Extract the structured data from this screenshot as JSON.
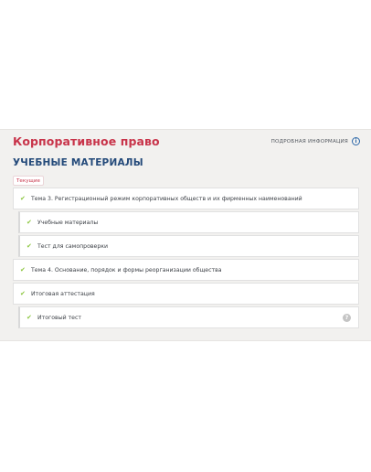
{
  "course": {
    "title": "Корпоративное право",
    "info_link": "ПОДРОБНАЯ ИНФОРМАЦИЯ",
    "info_icon": "info-icon"
  },
  "section": {
    "title": "УЧЕБНЫЕ МАТЕРИАЛЫ",
    "badge": "Текущие"
  },
  "items": [
    {
      "label": "Тема 3. Регистрационный режим корпоративных обществ и их фирменных наименований",
      "completed": true
    },
    {
      "label": "Учебные материалы",
      "completed": true
    },
    {
      "label": "Тест для самопроверки",
      "completed": true
    },
    {
      "label": "Тема 4. Основание, порядок и формы реорганизации общества",
      "completed": true
    },
    {
      "label": "Итоговая аттестация",
      "completed": true
    },
    {
      "label": "Итоговый тест",
      "completed": true,
      "help_icon": "?"
    }
  ],
  "colors": {
    "accent": "#c8344a",
    "heading": "#244a7a",
    "check": "#8cc63f"
  }
}
